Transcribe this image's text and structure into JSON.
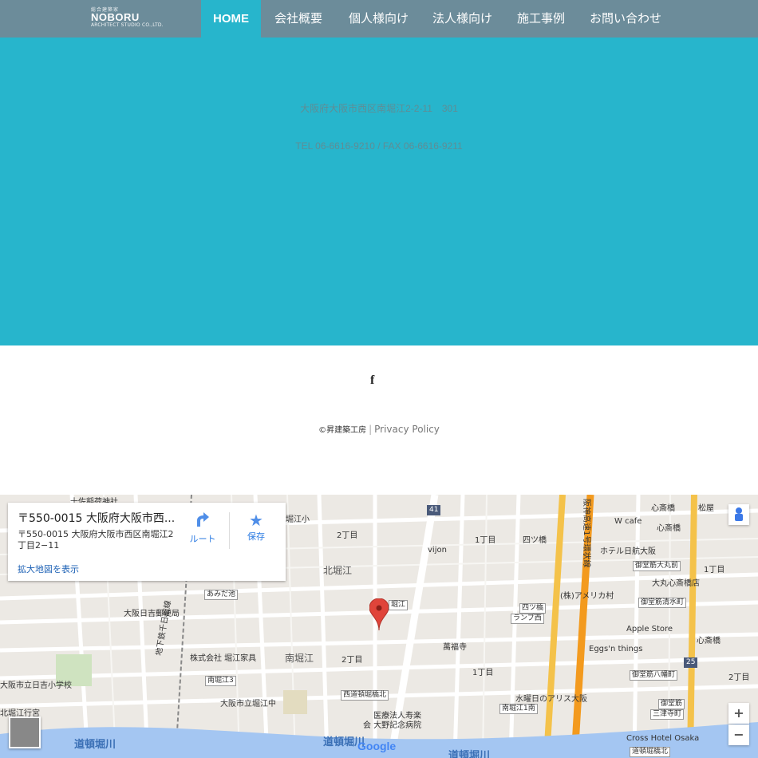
{
  "nav": {
    "logo_small": "総合建築家",
    "logo_main": "NOBORU",
    "logo_sub": "ARCHITECT STUDIO CO.,LTD.",
    "items": [
      "HOME",
      "会社概要",
      "個人様向け",
      "法人様向け",
      "施工事例",
      "お問い合わせ"
    ]
  },
  "hero": {
    "address": "大阪府大阪市西区南堀江2-2-11　301",
    "phone": "TEL 06-6616-9210 / FAX 06-6616-9211"
  },
  "footer": {
    "facebook_icon": "f",
    "copyright": "©昇建築工房",
    "separator": "|",
    "privacy": "Privacy Policy"
  },
  "map": {
    "card_title": "〒550-0015 大阪府大阪市西...",
    "card_address": "〒550-0015 大阪府大阪市西区南堀江2丁目2−11",
    "card_link": "拡大地図を表示",
    "route_label": "ルート",
    "save_label": "保存",
    "zoom_in": "+",
    "zoom_out": "−",
    "google": "Google",
    "labels": {
      "l1": "十佐稲荷神社",
      "l2": "堀江小",
      "l3": "2丁目",
      "l4": "1丁目",
      "l5": "四ツ橋",
      "l6": "心斎橋",
      "l7": "松屋",
      "l8": "心斎橋",
      "l9": "W cafe",
      "l10": "vijon",
      "l11": "北堀江",
      "l12": "ホテル日航大阪",
      "l13": "御堂筋大丸前",
      "l14": "大丸心斎橋店",
      "l15": "1丁目",
      "l16": "あみだ池",
      "l17": "堀江",
      "l18": "(株)アメリカ村",
      "l19": "御堂筋清水町",
      "l20": "大阪日吉郵便局",
      "l21": "四ツ橋",
      "l22": "ランプ西",
      "l23": "Apple Store",
      "l24": "心斎橋",
      "l25": "萬福寺",
      "l26": "株式会社 堀江家具",
      "l27": "南堀江",
      "l28": "2丁目",
      "l29": "Eggs'n things",
      "l30": "1丁目",
      "l31": "御堂筋八幡町",
      "l32": "2丁目",
      "l33": "大阪市立日吉小学校",
      "l34": "南堀江3",
      "l35": "西道頓堀橋北",
      "l36": "水曜日のアリス大阪",
      "l37": "南堀江1南",
      "l38": "御堂筋",
      "l39": "三津寺町",
      "l40": "大阪市立堀江中",
      "l41": "医療法人寿楽",
      "l42": "会 大野記念病院",
      "l43": "北堀江行宮",
      "l44": "道頓堀川",
      "l45": "道頓堀川",
      "l46": "道頓堀川",
      "l47": "Cross Hotel Osaka",
      "l48": "道頓堀橋北",
      "l49": "地下鉄千日前線",
      "l50": "阪神高速1号環状線",
      "l51": "41",
      "l52": "25",
      "l53": "ホ"
    }
  }
}
